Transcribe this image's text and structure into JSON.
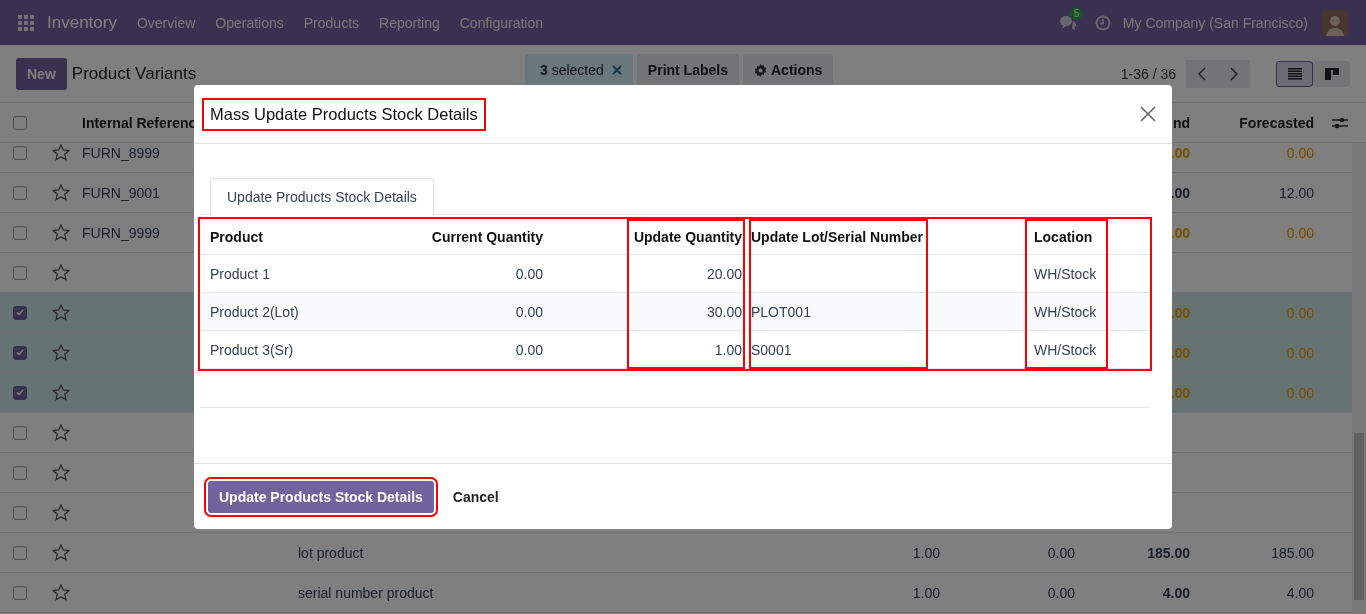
{
  "navbar": {
    "app": "Inventory",
    "menus": [
      "Overview",
      "Operations",
      "Products",
      "Reporting",
      "Configuration"
    ],
    "messages_badge": "5",
    "company": "My Company (San Francisco)"
  },
  "control_panel": {
    "new_button": "New",
    "title": "Product Variants",
    "selection": "**3** selected",
    "actions": [
      {
        "label": "Print Labels",
        "kind": "plain"
      },
      {
        "label": "Actions",
        "kind": "gear"
      }
    ],
    "pager": "1-36 / 36",
    "views": [
      {
        "kind": "list",
        "selected": true
      },
      {
        "kind": "kanban",
        "selected": false
      }
    ]
  },
  "list": {
    "header_checked": false,
    "columns": {
      "reference": "Internal Referenc",
      "on_hand": "nd",
      "forecasted": "Forecasted"
    },
    "rows": [
      {
        "selected": false,
        "reference": "FURN_8999",
        "on_hand": ".00",
        "forecasted": "0.00",
        "shortage": true
      },
      {
        "selected": false,
        "reference": "FURN_9001",
        "on_hand": ".00",
        "forecasted": "12.00",
        "shortage": false
      },
      {
        "selected": false,
        "reference": "FURN_9999",
        "on_hand": ".00",
        "forecasted": "0.00",
        "shortage": true
      },
      {
        "selected": false
      },
      {
        "selected": true,
        "on_hand": ".00",
        "forecasted": "0.00",
        "shortage": true
      },
      {
        "selected": true,
        "on_hand": ".00",
        "forecasted": "0.00",
        "shortage": true
      },
      {
        "selected": true,
        "on_hand": ".00",
        "forecasted": "0.00",
        "shortage": true
      },
      {
        "selected": false
      },
      {
        "selected": false
      },
      {
        "selected": false
      },
      {
        "selected": false,
        "name": "lot product",
        "col_a": "1.00",
        "col_b": "0.00",
        "on_hand": "185.00",
        "forecasted": "185.00",
        "shortage": false
      },
      {
        "selected": false,
        "name": "serial number product",
        "col_a": "1.00",
        "col_b": "0.00",
        "on_hand": "4.00",
        "forecasted": "4.00",
        "shortage": false
      }
    ]
  },
  "dialog": {
    "title": "Mass Update Products Stock Details",
    "title_highlighted": true,
    "tabs": [
      {
        "label": "Update Products Stock Details",
        "selected": true
      }
    ],
    "table": {
      "highlighted": true,
      "columns": [
        {
          "label": "Product",
          "kind": "text",
          "highlighted": false
        },
        {
          "label": "Current Quantity",
          "kind": "number",
          "highlighted": false
        },
        {
          "label": "Update Quantity",
          "kind": "number",
          "highlighted": true
        },
        {
          "label": "Update Lot/Serial Number",
          "kind": "text",
          "highlighted": true
        },
        {
          "label": "Location",
          "kind": "text",
          "highlighted": true
        }
      ],
      "rows": [
        {
          "product": "Product 1",
          "current_quantity": "0.00",
          "update_quantity": "20.00",
          "location": "WH/Stock"
        },
        {
          "product": "Product 2(Lot)",
          "current_quantity": "0.00",
          "update_quantity": "30.00",
          "lot": "PLOT001",
          "location": "WH/Stock"
        },
        {
          "product": "Product 3(Sr)",
          "current_quantity": "0.00",
          "update_quantity": "1.00",
          "lot": "S0001",
          "location": "WH/Stock"
        }
      ]
    },
    "buttons": [
      {
        "label": "Update Products Stock Details",
        "kind": "primary",
        "highlighted": true
      },
      {
        "label": "Cancel",
        "kind": "secondary",
        "highlighted": false
      }
    ]
  }
}
